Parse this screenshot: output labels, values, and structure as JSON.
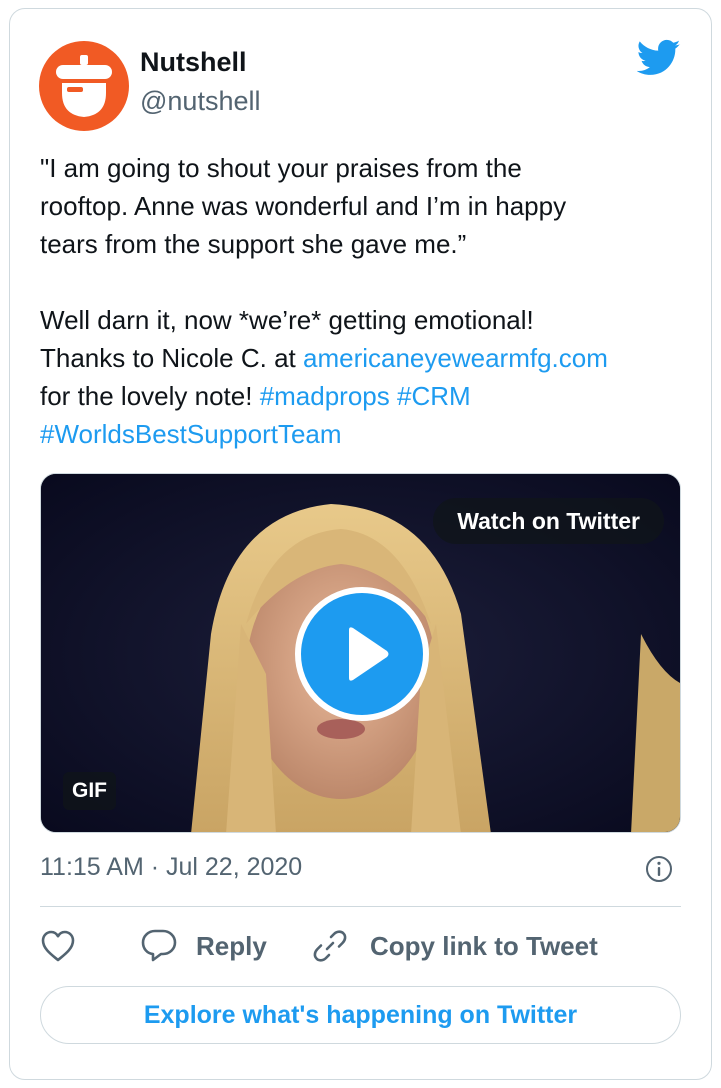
{
  "tweet": {
    "author": {
      "name": "Nutshell",
      "handle": "@nutshell"
    },
    "text": {
      "quote_lines": [
        "\"I am going to shout your praises from the",
        "rooftop. Anne was wonderful and I’m in happy",
        "tears from the support she gave me.”"
      ],
      "line4": "Well darn it, now *we’re* getting emotional!",
      "line5_prefix": "Thanks to Nicole C. at ",
      "link_url": "americaneyewearmfg.com",
      "line6_prefix": "for the lovely note! ",
      "hashtag_madprops": "#madprops",
      "hashtag_crm": "#CRM",
      "hashtag_team": "#WorldsBestSupportTeam"
    },
    "media": {
      "watch_label": "Watch on Twitter",
      "badge": "GIF"
    },
    "timestamp": "11:15 AM · Jul 22, 2020",
    "actions": {
      "reply_label": "Reply",
      "copy_label": "Copy link to Tweet"
    },
    "explore_label": "Explore what's happening on Twitter"
  },
  "colors": {
    "brand_blue": "#1d9bf0",
    "avatar_orange": "#f15a24",
    "secondary_text": "#536471",
    "border": "#cfd9de"
  },
  "icons": [
    "nutshell-acorn-logo",
    "twitter-bird-icon",
    "play-icon",
    "info-icon",
    "heart-icon",
    "reply-bubble-icon",
    "link-icon"
  ]
}
